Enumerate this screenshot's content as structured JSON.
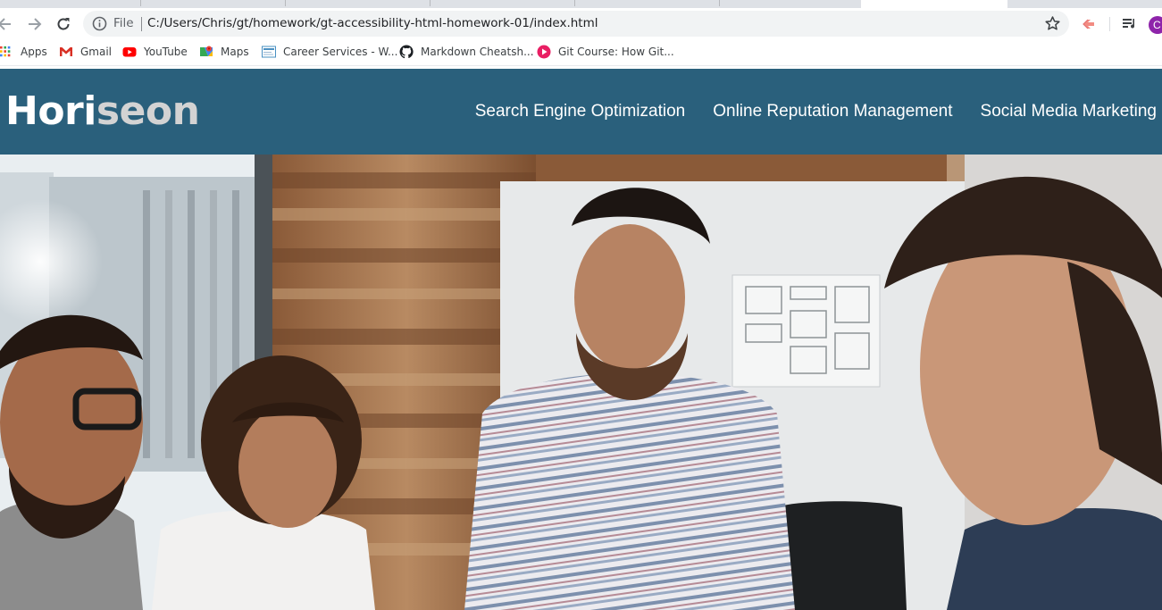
{
  "browser": {
    "scheme_label": "File",
    "url": "C:/Users/Chris/gt/homework/gt-accessibility-html-homework-01/index.html",
    "profile_initial": "C",
    "bookmarks": [
      {
        "label": "Apps",
        "icon": "apps-grid-icon"
      },
      {
        "label": "Gmail",
        "icon": "gmail-icon"
      },
      {
        "label": "YouTube",
        "icon": "youtube-icon"
      },
      {
        "label": "Maps",
        "icon": "maps-icon"
      },
      {
        "label": "Career Services - W...",
        "icon": "career-services-icon"
      },
      {
        "label": "Markdown Cheatsh...",
        "icon": "github-icon"
      },
      {
        "label": "Git Course: How Git...",
        "icon": "git-course-icon"
      }
    ]
  },
  "site": {
    "logo_part1": "Hori",
    "logo_part2": "seon",
    "nav": [
      {
        "label": "Search Engine Optimization"
      },
      {
        "label": "Online Reputation Management"
      },
      {
        "label": "Social Media Marketing"
      }
    ],
    "colors": {
      "header_bg": "#2a607c",
      "logo_accent": "#d3d3d3",
      "nav_text": "#ffffff"
    }
  }
}
